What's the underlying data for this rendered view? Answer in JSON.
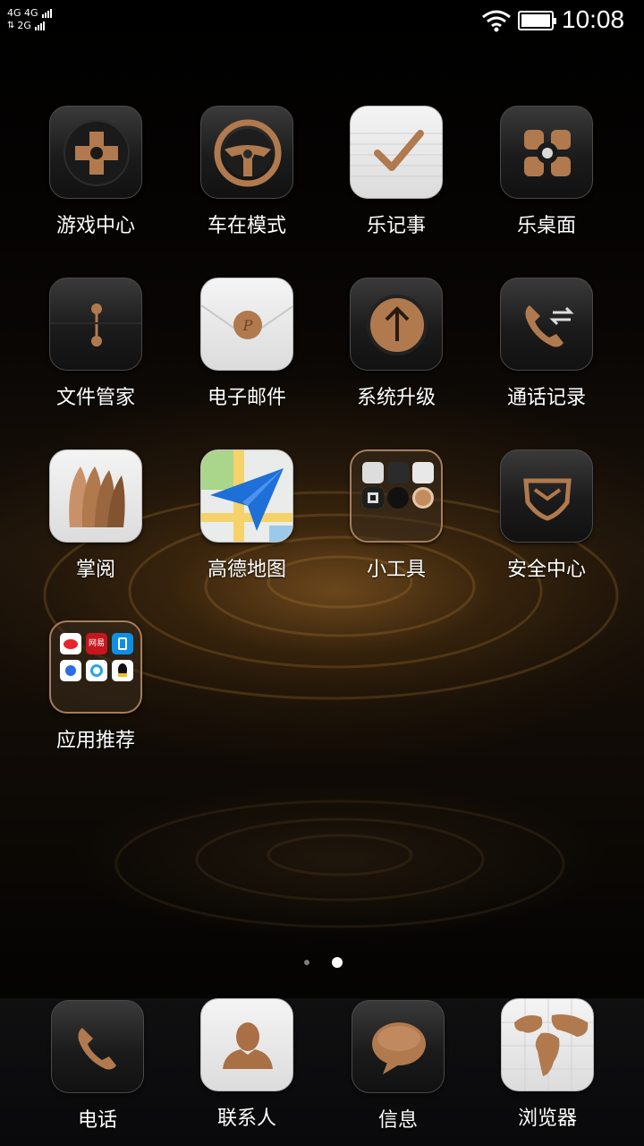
{
  "status_bar": {
    "network_line1": "4G 4G",
    "network_line2": "2G",
    "time": "10:08",
    "wifi_icon": "wifi-icon",
    "battery_icon": "battery-full-icon"
  },
  "apps": [
    {
      "label": "游戏中心",
      "icon": "gamepad-icon"
    },
    {
      "label": "车在模式",
      "icon": "steering-wheel-icon"
    },
    {
      "label": "乐记事",
      "icon": "checkmark-note-icon"
    },
    {
      "label": "乐桌面",
      "icon": "launcher-petals-icon"
    },
    {
      "label": "文件管家",
      "icon": "file-folder-icon"
    },
    {
      "label": "电子邮件",
      "icon": "envelope-icon"
    },
    {
      "label": "系统升级",
      "icon": "upgrade-arrow-icon"
    },
    {
      "label": "通话记录",
      "icon": "call-log-icon"
    },
    {
      "label": "掌阅",
      "icon": "reader-pages-icon"
    },
    {
      "label": "高德地图",
      "icon": "map-paperplane-icon"
    },
    {
      "label": "小工具",
      "icon": "tools-folder-icon"
    },
    {
      "label": "安全中心",
      "icon": "security-shield-icon"
    },
    {
      "label": "应用推荐",
      "icon": "recommended-apps-folder-icon"
    }
  ],
  "folder_apps": {
    "recommend_badges": [
      "网易"
    ]
  },
  "page_indicator": {
    "total": 2,
    "current": 2
  },
  "dock": [
    {
      "label": "电话",
      "icon": "phone-icon"
    },
    {
      "label": "联系人",
      "icon": "contacts-icon"
    },
    {
      "label": "信息",
      "icon": "message-bubble-icon"
    },
    {
      "label": "浏览器",
      "icon": "globe-browser-icon"
    }
  ],
  "colors": {
    "accent_bronze": "#b07a4e",
    "label": "#ffffff"
  }
}
